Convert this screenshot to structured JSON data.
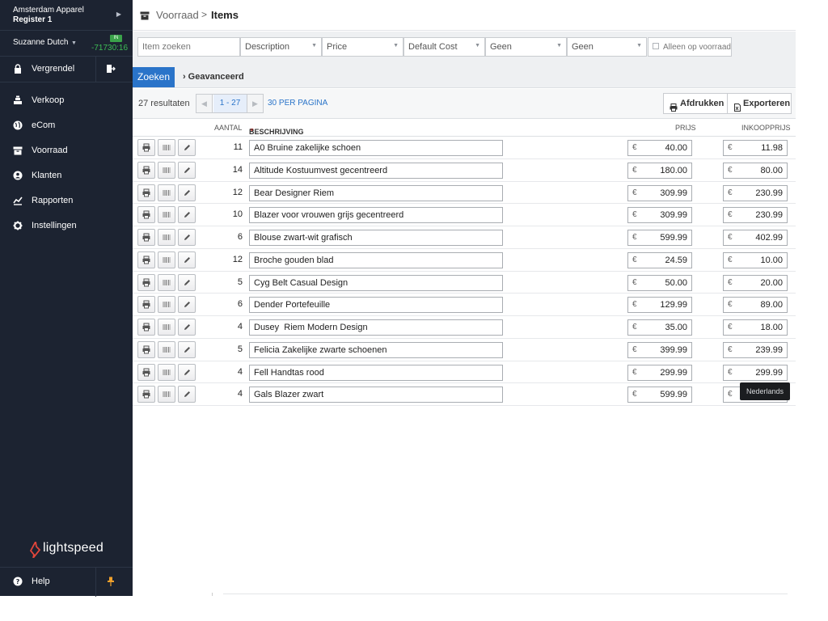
{
  "sidebar": {
    "store_name": "Amsterdam Apparel",
    "register": "Register 1",
    "user_name": "Suzanne Dutch",
    "status_badge": "IN",
    "timer": "-71730:16",
    "lock_label": "Vergrendel",
    "nav": [
      {
        "label": "Verkoop",
        "icon": "register-icon"
      },
      {
        "label": "eCom",
        "icon": "globe-icon"
      },
      {
        "label": "Voorraad",
        "icon": "inventory-icon"
      },
      {
        "label": "Klanten",
        "icon": "customer-icon"
      },
      {
        "label": "Rapporten",
        "icon": "chart-icon"
      },
      {
        "label": "Instellingen",
        "icon": "gear-icon"
      }
    ],
    "logo_text": "lightspeed",
    "help_label": "Help",
    "colors": {
      "background": "#1c2331",
      "timer": "#3dbd55",
      "pin": "#f0a02b",
      "logo_flame": "#e2463b"
    }
  },
  "header": {
    "breadcrumb_parent": "Voorraad",
    "breadcrumb_sep": ">",
    "breadcrumb_current": "Items"
  },
  "filters": {
    "search_placeholder": "Item zoeken",
    "selects": [
      "Description",
      "Price",
      "Default Cost",
      "Geen",
      "Geen"
    ],
    "in_stock_label": "Alleen op voorraad",
    "search_button": "Zoeken",
    "advanced_label": "Geavanceerd"
  },
  "results": {
    "count_label": "27 resultaten",
    "page_range": "1 - 27",
    "per_page": "30 PER PAGINA",
    "print_label": "Afdrukken",
    "export_label": "Exporteren"
  },
  "table": {
    "headers": {
      "qty": "AANTAL",
      "desc": "BESCHRIJVING",
      "price": "PRIJS",
      "cost": "INKOOPPRIJS"
    },
    "currency": "€",
    "rows": [
      {
        "qty": "11",
        "desc": "A0 Bruine zakelijke schoen",
        "price": "40.00",
        "cost": "11.98"
      },
      {
        "qty": "14",
        "desc": "Altitude Kostuumvest gecentreerd",
        "price": "180.00",
        "cost": "80.00"
      },
      {
        "qty": "12",
        "desc": "Bear Designer Riem",
        "price": "309.99",
        "cost": "230.99"
      },
      {
        "qty": "10",
        "desc": "Blazer voor vrouwen grijs gecentreerd",
        "price": "309.99",
        "cost": "230.99"
      },
      {
        "qty": "6",
        "desc": "Blouse zwart-wit grafisch",
        "price": "599.99",
        "cost": "402.99"
      },
      {
        "qty": "12",
        "desc": "Broche gouden blad",
        "price": "24.59",
        "cost": "10.00"
      },
      {
        "qty": "5",
        "desc": "Cyg Belt Casual Design",
        "price": "50.00",
        "cost": "20.00"
      },
      {
        "qty": "6",
        "desc": "Dender Portefeuille",
        "price": "129.99",
        "cost": "89.00"
      },
      {
        "qty": "4",
        "desc": "Dusey  Riem Modern Design",
        "price": "35.00",
        "cost": "18.00"
      },
      {
        "qty": "5",
        "desc": "Felicia Zakelijke zwarte schoenen",
        "price": "399.99",
        "cost": "239.99"
      },
      {
        "qty": "4",
        "desc": "Fell Handtas rood",
        "price": "299.99",
        "cost": "299.99"
      },
      {
        "qty": "4",
        "desc": "Gals Blazer zwart",
        "price": "599.99",
        "cost": ""
      }
    ]
  },
  "tooltip": {
    "text": "Nederlands"
  },
  "colors": {
    "accent": "#2a74c9",
    "sort_arrow": "#d0322b"
  }
}
